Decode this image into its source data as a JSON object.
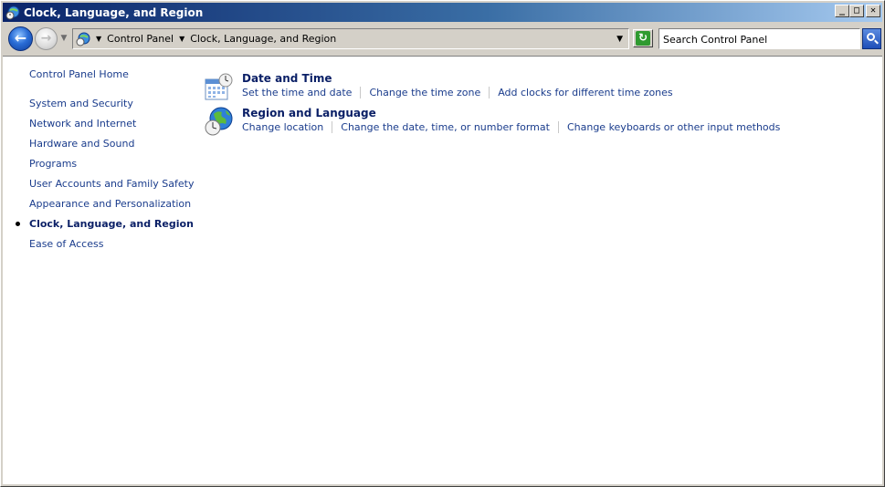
{
  "window": {
    "title": "Clock, Language, and Region",
    "minimize_label": "_",
    "maximize_label": "□",
    "close_label": "✕"
  },
  "address": {
    "breadcrumbs": [
      "Control Panel",
      "Clock, Language, and Region"
    ]
  },
  "search": {
    "placeholder": "Search Control Panel"
  },
  "sidebar": {
    "home": "Control Panel Home",
    "items": [
      "System and Security",
      "Network and Internet",
      "Hardware and Sound",
      "Programs",
      "User Accounts and Family Safety",
      "Appearance and Personalization",
      "Clock, Language, and Region",
      "Ease of Access"
    ],
    "current_item": "Clock, Language, and Region"
  },
  "sections": [
    {
      "title": "Date and Time",
      "icon": "calendar-clock-icon",
      "tasks": [
        "Set the time and date",
        "Change the time zone",
        "Add clocks for different time zones"
      ]
    },
    {
      "title": "Region and Language",
      "icon": "globe-clock-icon",
      "tasks": [
        "Change location",
        "Change the date, time, or number format",
        "Change keyboards or other input methods"
      ]
    }
  ],
  "colors": {
    "titlebar_start": "#0a246a",
    "titlebar_end": "#a6caf0",
    "link": "#1a3c8c",
    "heading": "#0a1f66",
    "chrome": "#d4d0c8"
  }
}
